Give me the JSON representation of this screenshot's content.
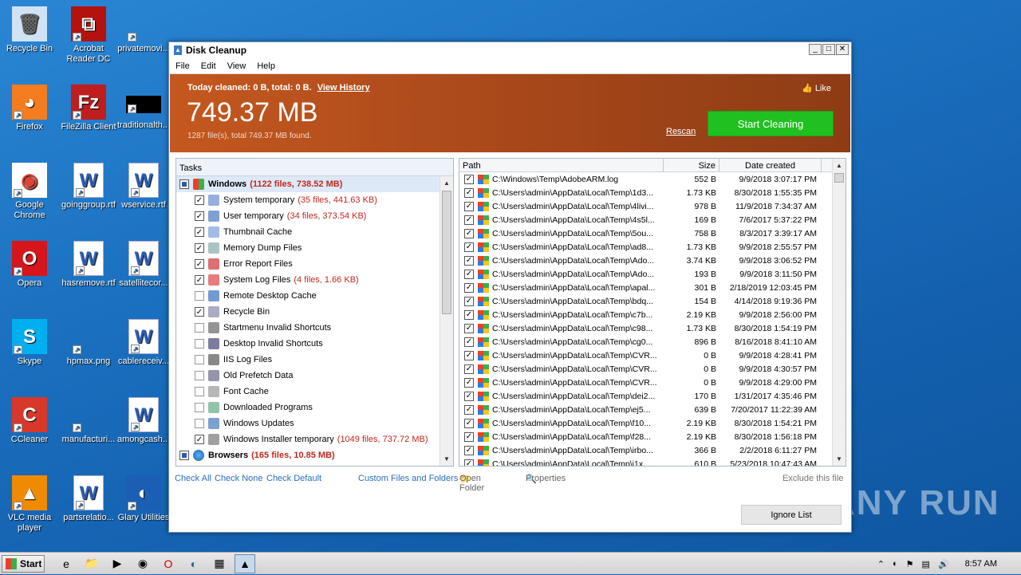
{
  "desktop": {
    "icons": [
      {
        "label": "Recycle Bin",
        "icon": "recycle-bin-icon"
      },
      {
        "label": "Acrobat Reader DC",
        "icon": "acrobat-icon"
      },
      {
        "label": "privatemovi...",
        "icon": "blank-file-icon"
      },
      {
        "label": "Firefox",
        "icon": "firefox-icon"
      },
      {
        "label": "FileZilla Client",
        "icon": "filezilla-icon"
      },
      {
        "label": "traditionalth...",
        "icon": "black-file-icon"
      },
      {
        "label": "Google Chrome",
        "icon": "chrome-icon"
      },
      {
        "label": "goinggroup.rtf",
        "icon": "word-doc-icon"
      },
      {
        "label": "wservice.rtf",
        "icon": "word-doc-icon"
      },
      {
        "label": "Opera",
        "icon": "opera-icon"
      },
      {
        "label": "hasremove.rtf",
        "icon": "word-doc-icon"
      },
      {
        "label": "satellitecor...",
        "icon": "word-doc-icon"
      },
      {
        "label": "Skype",
        "icon": "skype-icon"
      },
      {
        "label": "hpmax.png",
        "icon": "blank-file-icon"
      },
      {
        "label": "cablereceiv...",
        "icon": "word-doc-icon"
      },
      {
        "label": "CCleaner",
        "icon": "ccleaner-icon"
      },
      {
        "label": "manufacturi...",
        "icon": "blank-file-icon"
      },
      {
        "label": "amongcash...",
        "icon": "word-doc-icon"
      },
      {
        "label": "VLC media player",
        "icon": "vlc-icon"
      },
      {
        "label": "partsrelatio...",
        "icon": "word-doc-icon"
      },
      {
        "label": "Glary Utilities",
        "icon": "glary-icon"
      }
    ]
  },
  "window": {
    "title": "Disk Cleanup",
    "controls": {
      "minimize": "_",
      "maximize": "□",
      "close": "✕"
    },
    "menu": [
      "File",
      "Edit",
      "View",
      "Help"
    ]
  },
  "header": {
    "today": "Today cleaned: 0 B, total: 0 B.",
    "view_history": "View History",
    "total_size": "749.37 MB",
    "found": "1287 file(s), total 749.37 MB found.",
    "like": "Like",
    "rescan": "Rescan",
    "start_cleaning": "Start Cleaning"
  },
  "tasks": {
    "header": "Tasks",
    "groups": [
      {
        "name": "Windows",
        "count": "(1122 files, 738.52 MB)"
      },
      {
        "name": "Browsers",
        "count": "(165 files, 10.85 MB)"
      }
    ],
    "items": [
      {
        "label": "System temporary",
        "count": "(35 files, 441.63 KB)",
        "checked": true
      },
      {
        "label": "User temporary",
        "count": "(34 files, 373.54 KB)",
        "checked": true
      },
      {
        "label": "Thumbnail Cache",
        "count": "",
        "checked": true
      },
      {
        "label": "Memory Dump Files",
        "count": "",
        "checked": true
      },
      {
        "label": "Error Report Files",
        "count": "",
        "checked": true
      },
      {
        "label": "System Log Files",
        "count": "(4 files, 1.66 KB)",
        "checked": true
      },
      {
        "label": "Remote Desktop Cache",
        "count": "",
        "checked": false
      },
      {
        "label": "Recycle Bin",
        "count": "",
        "checked": true
      },
      {
        "label": "Startmenu Invalid Shortcuts",
        "count": "",
        "checked": false
      },
      {
        "label": "Desktop Invalid Shortcuts",
        "count": "",
        "checked": false
      },
      {
        "label": "IIS Log Files",
        "count": "",
        "checked": false
      },
      {
        "label": "Old Prefetch Data",
        "count": "",
        "checked": false
      },
      {
        "label": "Font Cache",
        "count": "",
        "checked": false
      },
      {
        "label": "Downloaded Programs",
        "count": "",
        "checked": false
      },
      {
        "label": "Windows Updates",
        "count": "",
        "checked": false
      },
      {
        "label": "Windows Installer temporary",
        "count": "(1049 files, 737.72 MB)",
        "checked": true
      }
    ]
  },
  "results": {
    "columns": [
      "Path",
      "Size",
      "Date created"
    ],
    "rows": [
      [
        "C:\\Windows\\Temp\\AdobeARM.log",
        "552 B",
        "9/9/2018 3:07:17 PM"
      ],
      [
        "C:\\Users\\admin\\AppData\\Local\\Temp\\1d3...",
        "1.73 KB",
        "8/30/2018 1:55:35 PM"
      ],
      [
        "C:\\Users\\admin\\AppData\\Local\\Temp\\4livi...",
        "978 B",
        "11/9/2018 7:34:37 AM"
      ],
      [
        "C:\\Users\\admin\\AppData\\Local\\Temp\\4s5l...",
        "169 B",
        "7/6/2017 5:37:22 PM"
      ],
      [
        "C:\\Users\\admin\\AppData\\Local\\Temp\\5ou...",
        "758 B",
        "8/3/2017 3:39:17 AM"
      ],
      [
        "C:\\Users\\admin\\AppData\\Local\\Temp\\ad8...",
        "1.73 KB",
        "9/9/2018 2:55:57 PM"
      ],
      [
        "C:\\Users\\admin\\AppData\\Local\\Temp\\Ado...",
        "3.74 KB",
        "9/9/2018 3:06:52 PM"
      ],
      [
        "C:\\Users\\admin\\AppData\\Local\\Temp\\Ado...",
        "193 B",
        "9/9/2018 3:11:50 PM"
      ],
      [
        "C:\\Users\\admin\\AppData\\Local\\Temp\\apal...",
        "301 B",
        "2/18/2019 12:03:45 PM"
      ],
      [
        "C:\\Users\\admin\\AppData\\Local\\Temp\\bdq...",
        "154 B",
        "4/14/2018 9:19:36 PM"
      ],
      [
        "C:\\Users\\admin\\AppData\\Local\\Temp\\c7b...",
        "2.19 KB",
        "9/9/2018 2:56:00 PM"
      ],
      [
        "C:\\Users\\admin\\AppData\\Local\\Temp\\c98...",
        "1.73 KB",
        "8/30/2018 1:54:19 PM"
      ],
      [
        "C:\\Users\\admin\\AppData\\Local\\Temp\\cg0...",
        "896 B",
        "8/16/2018 8:41:10 AM"
      ],
      [
        "C:\\Users\\admin\\AppData\\Local\\Temp\\CVR...",
        "0 B",
        "9/9/2018 4:28:41 PM"
      ],
      [
        "C:\\Users\\admin\\AppData\\Local\\Temp\\CVR...",
        "0 B",
        "9/9/2018 4:30:57 PM"
      ],
      [
        "C:\\Users\\admin\\AppData\\Local\\Temp\\CVR...",
        "0 B",
        "9/9/2018 4:29:00 PM"
      ],
      [
        "C:\\Users\\admin\\AppData\\Local\\Temp\\dei2...",
        "170 B",
        "1/31/2017 4:35:46 PM"
      ],
      [
        "C:\\Users\\admin\\AppData\\Local\\Temp\\ej5...",
        "639 B",
        "7/20/2017 11:22:39 AM"
      ],
      [
        "C:\\Users\\admin\\AppData\\Local\\Temp\\f10...",
        "2.19 KB",
        "8/30/2018 1:54:21 PM"
      ],
      [
        "C:\\Users\\admin\\AppData\\Local\\Temp\\f28...",
        "2.19 KB",
        "8/30/2018 1:56:18 PM"
      ],
      [
        "C:\\Users\\admin\\AppData\\Local\\Temp\\irbo...",
        "366 B",
        "2/2/2018 6:11:27 PM"
      ],
      [
        "C:\\Users\\admin\\AppData\\Local\\Temp\\i1x...",
        "610 B",
        "5/23/2018 10:47:43 AM"
      ]
    ]
  },
  "footer": {
    "check_all": "Check All",
    "check_none": "Check None",
    "check_default": "Check Default",
    "custom_files": "Custom Files and Folders",
    "open_folder": "Open Folder",
    "properties": "Properties",
    "exclude": "Exclude this file",
    "ignore_list": "Ignore List"
  },
  "watermark": "ANY RUN",
  "taskbar": {
    "start": "Start",
    "time": "8:57 AM"
  },
  "colors": {
    "header_orange": "#c4581f",
    "start_green": "#20c020",
    "count_red": "#c0281e",
    "link_blue": "#2a6dc4"
  }
}
